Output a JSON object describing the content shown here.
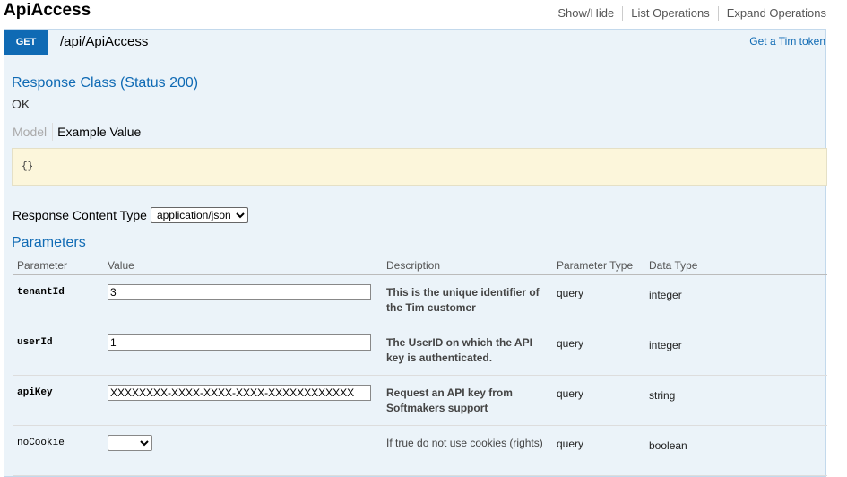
{
  "header": {
    "title": "ApiAccess",
    "links": [
      "Show/Hide",
      "List Operations",
      "Expand Operations"
    ]
  },
  "operation": {
    "method": "GET",
    "path": "/api/ApiAccess",
    "summary": "Get a Tim token",
    "method_color": "#0f6ab4"
  },
  "response_class": {
    "title": "Response Class (Status 200)",
    "status_text": "OK",
    "tabs": {
      "model": "Model",
      "example": "Example Value"
    },
    "example_value": "{}"
  },
  "response_content_type": {
    "label": "Response Content Type",
    "selected": "application/json"
  },
  "parameters": {
    "title": "Parameters",
    "columns": [
      "Parameter",
      "Value",
      "Description",
      "Parameter Type",
      "Data Type"
    ],
    "rows": [
      {
        "name": "tenantId",
        "value": "3",
        "description": "This is the unique identifier of the Tim customer",
        "param_type": "query",
        "data_type": "integer"
      },
      {
        "name": "userId",
        "value": "1",
        "description": "The UserID on which the API key is authenticated.",
        "param_type": "query",
        "data_type": "integer"
      },
      {
        "name": "apiKey",
        "value": "XXXXXXXX-XXXX-XXXX-XXXX-XXXXXXXXXXXX",
        "description": "Request an API key from Softmakers support",
        "param_type": "query",
        "data_type": "string"
      },
      {
        "name": "noCookie",
        "value": "",
        "description": "If true do not use cookies (rights)",
        "param_type": "query",
        "data_type": "boolean"
      }
    ]
  }
}
